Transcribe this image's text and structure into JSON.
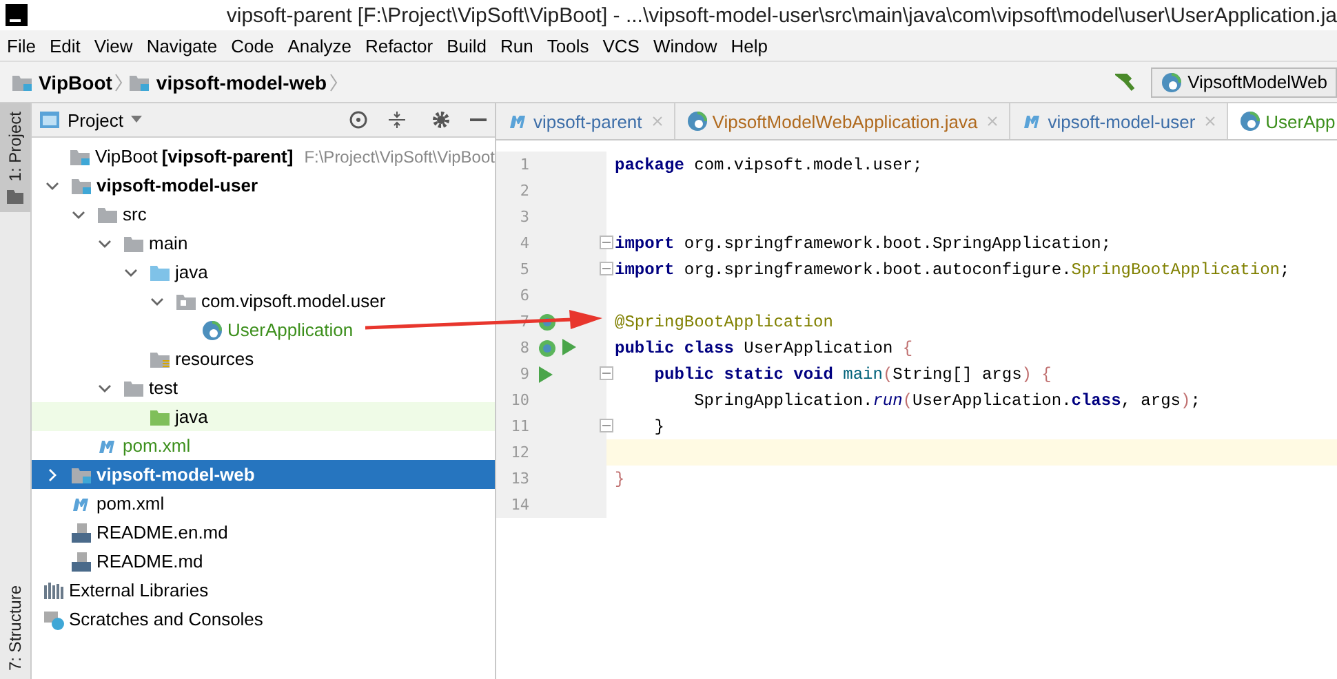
{
  "window": {
    "title": "vipsoft-parent [F:\\Project\\VipSoft\\VipBoot] - ...\\vipsoft-model-user\\src\\main\\java\\com\\vipsoft\\model\\user\\UserApplication.ja"
  },
  "menu": [
    "File",
    "Edit",
    "View",
    "Navigate",
    "Code",
    "Analyze",
    "Refactor",
    "Build",
    "Run",
    "Tools",
    "VCS",
    "Window",
    "Help"
  ],
  "breadcrumbs": [
    "VipBoot",
    "vipsoft-model-web"
  ],
  "run_config": {
    "label": "VipsoftModelWeb"
  },
  "side_strip": [
    "1: Project",
    "7: Structure"
  ],
  "project_panel": {
    "title": "Project"
  },
  "tree": [
    {
      "label": "VipBoot",
      "bold_part": "[vipsoft-parent]",
      "secondary": "F:\\Project\\VipSoft\\VipBoot",
      "kind": "module",
      "color": "#000000",
      "bold": false,
      "selected": false
    },
    {
      "label": "vipsoft-model-user",
      "kind": "module",
      "bold": true,
      "color": "#000000",
      "selected": false,
      "expanded": true,
      "children": [
        {
          "label": "src",
          "kind": "folder",
          "color": "#000000",
          "bold": false,
          "selected": false,
          "expanded": true,
          "children": [
            {
              "label": "main",
              "kind": "folder",
              "color": "#000000",
              "bold": false,
              "selected": false,
              "expanded": true,
              "children": [
                {
                  "label": "java",
                  "kind": "source-folder",
                  "color": "#000000",
                  "bold": false,
                  "selected": false,
                  "expanded": true,
                  "children": [
                    {
                      "label": "com.vipsoft.model.user",
                      "kind": "package",
                      "color": "#000000",
                      "bold": false,
                      "selected": false,
                      "expanded": true,
                      "children": [
                        {
                          "label": "UserApplication",
                          "kind": "class",
                          "color": "#3c8f1c",
                          "bold": false,
                          "selected": false
                        }
                      ]
                    }
                  ]
                },
                {
                  "label": "resources",
                  "kind": "resources",
                  "color": "#000000",
                  "bold": false,
                  "selected": false
                }
              ]
            },
            {
              "label": "test",
              "kind": "folder",
              "color": "#000000",
              "bold": false,
              "selected": false,
              "expanded": true,
              "children": [
                {
                  "label": "java",
                  "kind": "test-folder",
                  "color": "#000000",
                  "bold": false,
                  "selected": false
                }
              ]
            }
          ]
        },
        {
          "label": "pom.xml",
          "kind": "maven",
          "color": "#3c8f1c",
          "bold": false,
          "selected": false
        }
      ]
    },
    {
      "label": "vipsoft-model-web",
      "kind": "module",
      "bold": true,
      "color": "#ffffff",
      "selected": true,
      "expanded": false
    },
    {
      "label": "pom.xml",
      "kind": "maven",
      "color": "#000000",
      "bold": false,
      "selected": false
    },
    {
      "label": "README.en.md",
      "kind": "markdown",
      "color": "#000000",
      "bold": false,
      "selected": false
    },
    {
      "label": "README.md",
      "kind": "markdown",
      "color": "#000000",
      "bold": false,
      "selected": false
    }
  ],
  "tree_roots": [
    {
      "label": "External Libraries",
      "kind": "libraries"
    },
    {
      "label": "Scratches and Consoles",
      "kind": "scratches"
    }
  ],
  "tabs": [
    {
      "label": "vipsoft-parent",
      "kind": "maven",
      "color": "#3d6ea8",
      "selected": false
    },
    {
      "label": "VipsoftModelWebApplication.java",
      "kind": "class",
      "color": "#b06a1e",
      "selected": false
    },
    {
      "label": "vipsoft-model-user",
      "kind": "maven",
      "color": "#3d6ea8",
      "selected": false
    },
    {
      "label": "UserApp",
      "kind": "class",
      "color": "#3c8f1c",
      "selected": true
    }
  ],
  "code": [
    {
      "number": "1",
      "current": false,
      "tokens": [
        {
          "kind": "keyword",
          "text": "package"
        },
        {
          "kind": "plain",
          "text": " com.vipsoft.model.user;"
        }
      ]
    },
    {
      "number": "2",
      "current": false
    },
    {
      "number": "3",
      "current": false
    },
    {
      "number": "4",
      "current": false,
      "fold": true,
      "tokens": [
        {
          "kind": "keyword",
          "text": "import"
        },
        {
          "kind": "plain",
          "text": " org.springframework.boot.SpringApplication;"
        }
      ]
    },
    {
      "number": "5",
      "current": false,
      "fold": true,
      "tokens": [
        {
          "kind": "keyword",
          "text": "import"
        },
        {
          "kind": "plain",
          "text": " org.springframework.boot.autoconfigure."
        },
        {
          "kind": "annotation",
          "text": "SpringBootApplication"
        },
        {
          "kind": "plain",
          "text": ";"
        }
      ]
    },
    {
      "number": "6",
      "current": false
    },
    {
      "number": "7",
      "current": false,
      "gutter": [
        {
          "kind": "bean"
        }
      ],
      "tokens": [
        {
          "kind": "annotation",
          "text": "@SpringBootApplication"
        }
      ]
    },
    {
      "number": "8",
      "current": false,
      "gutter": [
        {
          "kind": "bean"
        },
        {
          "kind": "run"
        }
      ],
      "tokens": [
        {
          "kind": "keyword",
          "text": "public class"
        },
        {
          "kind": "plain",
          "text": " UserApplication "
        },
        {
          "kind": "brace",
          "text": "{"
        }
      ]
    },
    {
      "number": "9",
      "current": false,
      "gutter": [
        {
          "kind": "run"
        }
      ],
      "fold": true,
      "tokens": [
        {
          "kind": "keyword",
          "text": "    public static void "
        },
        {
          "kind": "method",
          "text": "main"
        },
        {
          "kind": "brace",
          "text": "("
        },
        {
          "kind": "plain",
          "text": "String[] args"
        },
        {
          "kind": "brace",
          "text": ") {"
        }
      ]
    },
    {
      "number": "10",
      "current": false,
      "tokens": [
        {
          "kind": "plain",
          "text": "        SpringApplication."
        },
        {
          "kind": "static",
          "text": "run"
        },
        {
          "kind": "brace",
          "text": "("
        },
        {
          "kind": "plain",
          "text": "UserApplication."
        },
        {
          "kind": "keyword",
          "text": "class"
        },
        {
          "kind": "plain",
          "text": ", args"
        },
        {
          "kind": "brace",
          "text": ")"
        },
        {
          "kind": "plain",
          "text": ";"
        }
      ]
    },
    {
      "number": "11",
      "current": false,
      "fold": true,
      "tokens": [
        {
          "kind": "plain",
          "text": "    }"
        }
      ]
    },
    {
      "number": "12",
      "current": true
    },
    {
      "number": "13",
      "current": false,
      "tokens": [
        {
          "kind": "brace",
          "text": "}"
        }
      ]
    },
    {
      "number": "14",
      "current": false
    }
  ]
}
